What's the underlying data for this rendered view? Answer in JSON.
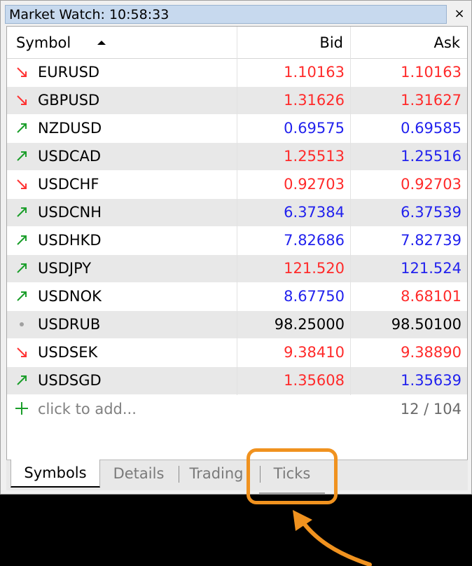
{
  "window": {
    "title": "Market Watch: 10:58:33",
    "close_label": "×"
  },
  "columns": {
    "symbol": "Symbol",
    "bid": "Bid",
    "ask": "Ask"
  },
  "colors": {
    "up": "#1a9e2a",
    "down": "#ff3333",
    "neutral": "#a0a0a0",
    "blue": "#2222ee",
    "red": "#ff2a2a",
    "black": "#000000",
    "highlight": "#f0921f"
  },
  "rows": [
    {
      "symbol": "EURUSD",
      "trend": "down",
      "bid": "1.10163",
      "bid_color": "red",
      "ask": "1.10163",
      "ask_color": "red"
    },
    {
      "symbol": "GBPUSD",
      "trend": "down",
      "bid": "1.31626",
      "bid_color": "red",
      "ask": "1.31627",
      "ask_color": "red"
    },
    {
      "symbol": "NZDUSD",
      "trend": "up",
      "bid": "0.69575",
      "bid_color": "blue",
      "ask": "0.69585",
      "ask_color": "blue"
    },
    {
      "symbol": "USDCAD",
      "trend": "up",
      "bid": "1.25513",
      "bid_color": "red",
      "ask": "1.25516",
      "ask_color": "blue"
    },
    {
      "symbol": "USDCHF",
      "trend": "down",
      "bid": "0.92703",
      "bid_color": "red",
      "ask": "0.92703",
      "ask_color": "red"
    },
    {
      "symbol": "USDCNH",
      "trend": "up",
      "bid": "6.37384",
      "bid_color": "blue",
      "ask": "6.37539",
      "ask_color": "blue"
    },
    {
      "symbol": "USDHKD",
      "trend": "up",
      "bid": "7.82686",
      "bid_color": "blue",
      "ask": "7.82739",
      "ask_color": "blue"
    },
    {
      "symbol": "USDJPY",
      "trend": "up",
      "bid": "121.520",
      "bid_color": "red",
      "ask": "121.524",
      "ask_color": "blue"
    },
    {
      "symbol": "USDNOK",
      "trend": "up",
      "bid": "8.67750",
      "bid_color": "blue",
      "ask": "8.68101",
      "ask_color": "red"
    },
    {
      "symbol": "USDRUB",
      "trend": "neutral",
      "bid": "98.25000",
      "bid_color": "black",
      "ask": "98.50100",
      "ask_color": "black"
    },
    {
      "symbol": "USDSEK",
      "trend": "down",
      "bid": "9.38410",
      "bid_color": "red",
      "ask": "9.38890",
      "ask_color": "red"
    },
    {
      "symbol": "USDSGD",
      "trend": "up",
      "bid": "1.35608",
      "bid_color": "red",
      "ask": "1.35639",
      "ask_color": "blue"
    }
  ],
  "add_row": {
    "label": "click to add...",
    "count": "12 / 104"
  },
  "tabs": [
    {
      "label": "Symbols",
      "active": true
    },
    {
      "label": "Details",
      "active": false
    },
    {
      "label": "Trading",
      "active": false
    },
    {
      "label": "Ticks",
      "active": false
    }
  ]
}
